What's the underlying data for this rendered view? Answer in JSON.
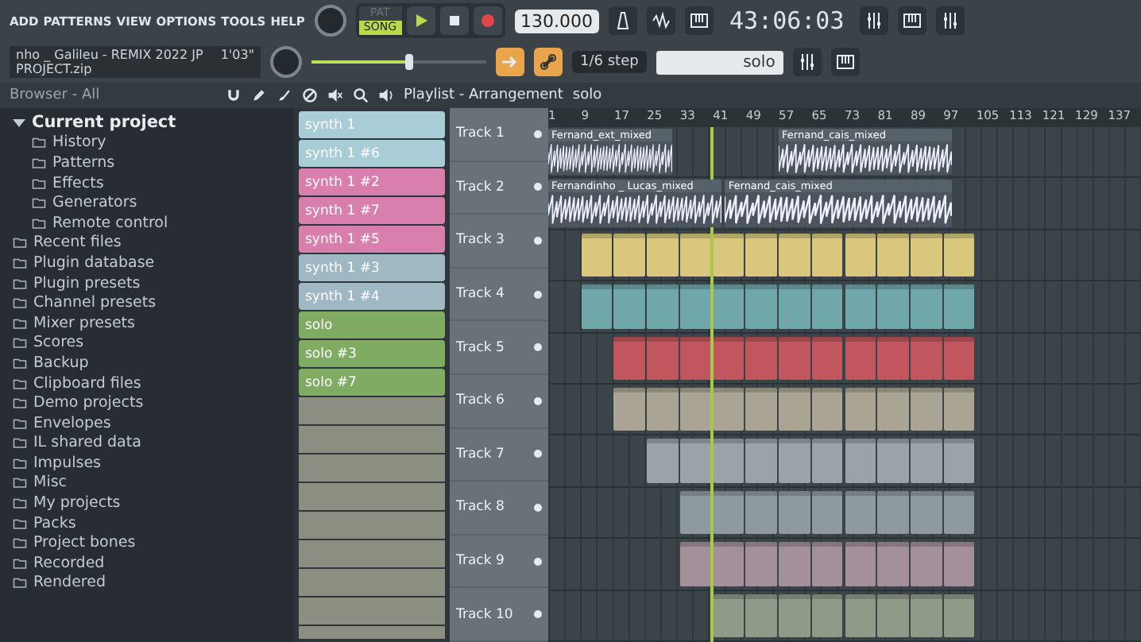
{
  "menu": [
    "ADD",
    "PATTERNS",
    "VIEW",
    "OPTIONS",
    "TOOLS",
    "HELP"
  ],
  "mode_buttons": [
    {
      "label": "PAT",
      "selected": false
    },
    {
      "label": "SONG",
      "selected": true
    }
  ],
  "tempo": "130.000",
  "time": "43:06:03",
  "project": {
    "title": "nho _ Galileu  - REMIX 2022 JP PROJECT.zip",
    "length": "1'03\""
  },
  "master_slider": {
    "level": 0.55
  },
  "snap": "1/6 step",
  "pattern_selector": "solo",
  "browser": {
    "title": "Browser - All",
    "tree": [
      {
        "label": "Current project",
        "expanded": true,
        "children": [
          {
            "label": "History"
          },
          {
            "label": "Patterns"
          },
          {
            "label": "Effects"
          },
          {
            "label": "Generators"
          },
          {
            "label": "Remote control"
          }
        ]
      },
      {
        "label": "Recent files"
      },
      {
        "label": "Plugin database"
      },
      {
        "label": "Plugin presets"
      },
      {
        "label": "Channel presets"
      },
      {
        "label": "Mixer presets"
      },
      {
        "label": "Scores"
      },
      {
        "label": "Backup"
      },
      {
        "label": "Clipboard files"
      },
      {
        "label": "Demo projects"
      },
      {
        "label": "Envelopes"
      },
      {
        "label": "IL shared data"
      },
      {
        "label": "Impulses"
      },
      {
        "label": "Misc"
      },
      {
        "label": "My projects"
      },
      {
        "label": "Packs"
      },
      {
        "label": "Project bones"
      },
      {
        "label": "Recorded"
      },
      {
        "label": "Rendered"
      }
    ]
  },
  "patterns": [
    {
      "name": "synth 1",
      "color": "#a9cdd6"
    },
    {
      "name": "synth 1 #6",
      "color": "#a9cdd6"
    },
    {
      "name": "synth 1 #2",
      "color": "#d97fae"
    },
    {
      "name": "synth 1 #7",
      "color": "#d97fae"
    },
    {
      "name": "synth 1 #5",
      "color": "#d97fae"
    },
    {
      "name": "synth 1 #3",
      "color": "#9fb8c4"
    },
    {
      "name": "synth 1 #4",
      "color": "#9fb8c4"
    },
    {
      "name": "solo",
      "color": "#7fab62"
    },
    {
      "name": "solo #3",
      "color": "#7fab62"
    },
    {
      "name": "solo #7",
      "color": "#7fab62"
    }
  ],
  "playlist": {
    "title": "Playlist - Arrangement",
    "breadcrumb": "solo",
    "ruler": [
      "1",
      "9",
      "17",
      "25",
      "33",
      "41",
      "49",
      "57",
      "65",
      "73",
      "81",
      "89",
      "97",
      "105",
      "113",
      "121",
      "129",
      "137"
    ],
    "tracks": [
      {
        "name": "Track 1",
        "kind": "audio",
        "clips": [
          {
            "name": "Fernand_ext_mixed"
          },
          {
            "name": "Fernand_cais_mixed"
          }
        ]
      },
      {
        "name": "Track 2",
        "kind": "audio",
        "clips": [
          {
            "name": "Fernandinho _ Lucas_mixed"
          },
          {
            "name": "Fernand_cais_mixed"
          }
        ]
      },
      {
        "name": "Track 3",
        "kind": "pattern",
        "color": "#d9c77e"
      },
      {
        "name": "Track 4",
        "kind": "pattern",
        "color": "#6fa7ab"
      },
      {
        "name": "Track 5",
        "kind": "pattern",
        "color": "#c2565f"
      },
      {
        "name": "Track 6",
        "kind": "pattern",
        "color": "#a9a494"
      },
      {
        "name": "Track 7",
        "kind": "pattern",
        "color": "#9aa3a8"
      },
      {
        "name": "Track 8",
        "kind": "pattern",
        "color": "#8e9aa0"
      },
      {
        "name": "Track 9",
        "kind": "pattern",
        "color": "#a3909a"
      },
      {
        "name": "Track 10",
        "kind": "pattern",
        "color": "#8f9b88"
      }
    ]
  }
}
